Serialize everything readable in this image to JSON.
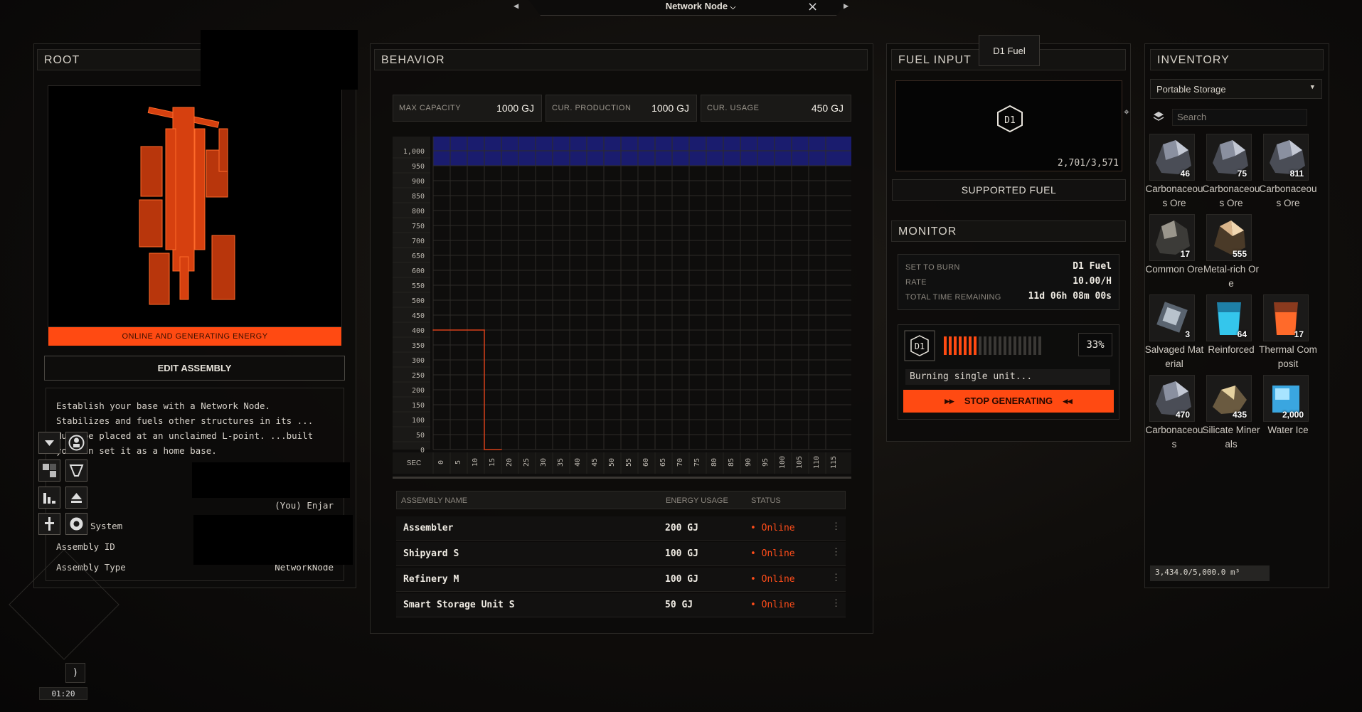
{
  "window": {
    "title": "Network Node"
  },
  "root": {
    "title": "ROOT",
    "status_bar": "ONLINE AND GENERATING ENERGY",
    "edit_button": "EDIT ASSEMBLY",
    "description": "Establish your base with a Network Node. Stabilizes and fuels other structures in its ... Must be placed at an unclaimed L-point. ...built you can set it as a home base.",
    "fields": [
      {
        "label": "",
        "value": "(You) Enjar"
      },
      {
        "label": "System",
        "value": ""
      },
      {
        "label": "Assembly ID",
        "value": ""
      },
      {
        "label": "Assembly Type",
        "value": "NetworkNode"
      }
    ],
    "timer": "01:20"
  },
  "behavior": {
    "title": "BEHAVIOR",
    "stats": [
      {
        "label": "MAX CAPACITY",
        "value": "1000 GJ"
      },
      {
        "label": "CUR. PRODUCTION",
        "value": "1000 GJ"
      },
      {
        "label": "CUR. USAGE",
        "value": "450 GJ"
      }
    ],
    "table": {
      "headers": [
        "ASSEMBLY NAME",
        "ENERGY USAGE",
        "STATUS"
      ],
      "rows": [
        {
          "name": "Assembler",
          "usage": "200 GJ",
          "status": "• Online"
        },
        {
          "name": "Shipyard S",
          "usage": "100 GJ",
          "status": "• Online"
        },
        {
          "name": "Refinery M",
          "usage": "100 GJ",
          "status": "• Online"
        },
        {
          "name": "Smart Storage Unit S",
          "usage": "50 GJ",
          "status": "• Online"
        }
      ]
    }
  },
  "chart_data": {
    "type": "line",
    "title": "",
    "xlabel": "SEC",
    "ylabel": "",
    "x": [
      0,
      5,
      10,
      15,
      20,
      25,
      30,
      35,
      40,
      45,
      50,
      55,
      60,
      65,
      70,
      75,
      80,
      85,
      90,
      95,
      100,
      105,
      110,
      115
    ],
    "ylim": [
      0,
      1000
    ],
    "yticks": [
      0,
      50,
      100,
      150,
      200,
      250,
      300,
      350,
      400,
      450,
      500,
      550,
      600,
      650,
      700,
      750,
      800,
      850,
      900,
      950,
      1000
    ],
    "capacity": 1000,
    "series": [
      {
        "name": "",
        "points": [
          [
            0,
            400
          ],
          [
            15,
            400
          ],
          [
            15,
            0
          ],
          [
            20,
            0
          ]
        ],
        "color": "#d6401a"
      }
    ],
    "grid": true
  },
  "fuel": {
    "title": "FUEL INPUT",
    "tooltip": "D1 Fuel",
    "icon_label": "D1",
    "amount": "2,701/3,571",
    "supported_button": "SUPPORTED FUEL"
  },
  "monitor": {
    "title": "MONITOR",
    "rows": [
      {
        "label": "SET TO BURN",
        "value": "D1 Fuel"
      },
      {
        "label": "RATE",
        "value": "10.00/H"
      },
      {
        "label": "TOTAL TIME REMAINING",
        "value": "11d 06h 08m 00s"
      }
    ],
    "burn_icon": "D1",
    "progress_percent": 33,
    "progress_text": "33%",
    "status": "Burning single unit...",
    "stop_button": "STOP GENERATING"
  },
  "inventory": {
    "title": "INVENTORY",
    "storage": "Portable Storage",
    "search_placeholder": "Search",
    "capacity": "3,434.0/5,000.0 m³",
    "items": [
      {
        "name": "Carbonaceous Ore",
        "qty": "46",
        "kind": "ore"
      },
      {
        "name": "Carbonaceous Ore",
        "qty": "75",
        "kind": "ore"
      },
      {
        "name": "Carbonaceous Ore",
        "qty": "811",
        "kind": "ore"
      },
      {
        "name": "Common Ore",
        "qty": "17",
        "kind": "common"
      },
      {
        "name": "Metal-rich Ore",
        "qty": "555",
        "kind": "metal"
      },
      {
        "name": "Salvaged Material",
        "qty": "3",
        "kind": "salvage"
      },
      {
        "name": "Reinforced",
        "qty": "64",
        "kind": "blue"
      },
      {
        "name": "Thermal Composit",
        "qty": "17",
        "kind": "orange"
      },
      {
        "name": "Carbonaceous",
        "qty": "470",
        "kind": "ore"
      },
      {
        "name": "Silicate Minerals",
        "qty": "435",
        "kind": "silicate"
      },
      {
        "name": "Water Ice",
        "qty": "2,000",
        "kind": "ice"
      }
    ]
  },
  "colors": {
    "accent": "#ff4a12",
    "capacity_band": "#1c2080",
    "panel_bg": "#0c0b0a"
  }
}
